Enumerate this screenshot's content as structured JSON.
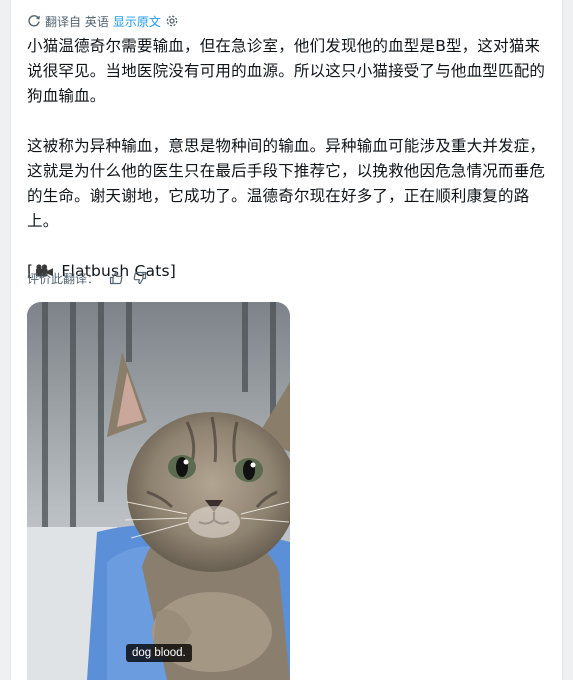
{
  "translation_bar": {
    "status": "翻译自 英语",
    "show_original_label": "显示原文"
  },
  "post": {
    "paragraph_1": "小猫温德奇尔需要输血，但在急诊室，他们发现他的血型是B型，这对猫来说很罕见。当地医院没有可用的血源。所以这只小猫接受了与他血型匹配的狗血输血。",
    "paragraph_2": "这被称为异种输血，意思是物种间的输血。异种输血可能涉及重大并发症，这就是为什么他的医生只在最后手段下推荐它，以挽救他因危急情况而垂危的生命。谢天谢地，它成功了。温德奇尔现在好多了，正在顺利康复的路上。",
    "credit_open": "[",
    "credit_icon": "video-camera-icon",
    "credit_text": "Flatbush Cats]"
  },
  "rating": {
    "label": "评价此翻译："
  },
  "media": {
    "caption": "dog blood."
  },
  "colors": {
    "link": "#1d9bf0",
    "muted": "#536471",
    "text": "#0f1419"
  }
}
